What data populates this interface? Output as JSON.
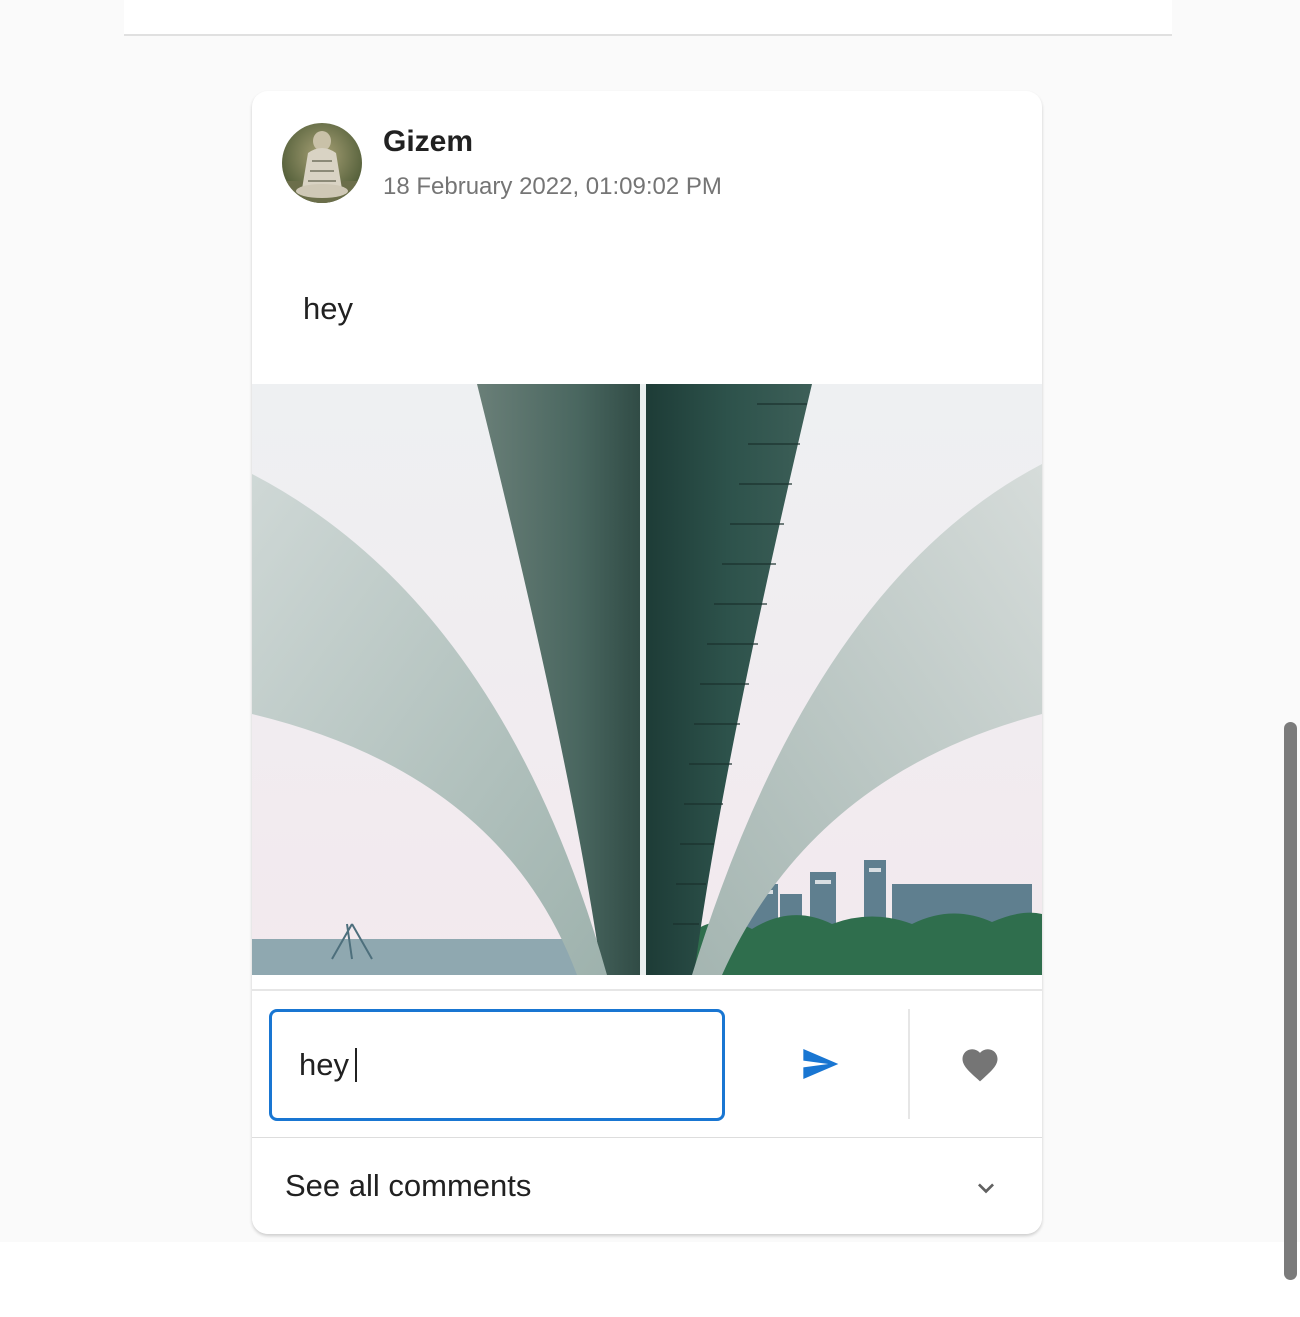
{
  "post": {
    "author": "Gizem",
    "timestamp": "18 February 2022, 01:09:02 PM",
    "text": "hey",
    "image_icon": "bridge-underside-photo",
    "avatar_icon": "user-avatar-photo"
  },
  "comment": {
    "input_value": "hey",
    "send_icon": "send-icon",
    "like_icon": "heart-icon"
  },
  "comments_section": {
    "label": "See all comments",
    "expand_icon": "chevron-down-icon"
  },
  "colors": {
    "accent": "#1976d2",
    "icon_gray": "#757575",
    "background": "#fafafa"
  }
}
